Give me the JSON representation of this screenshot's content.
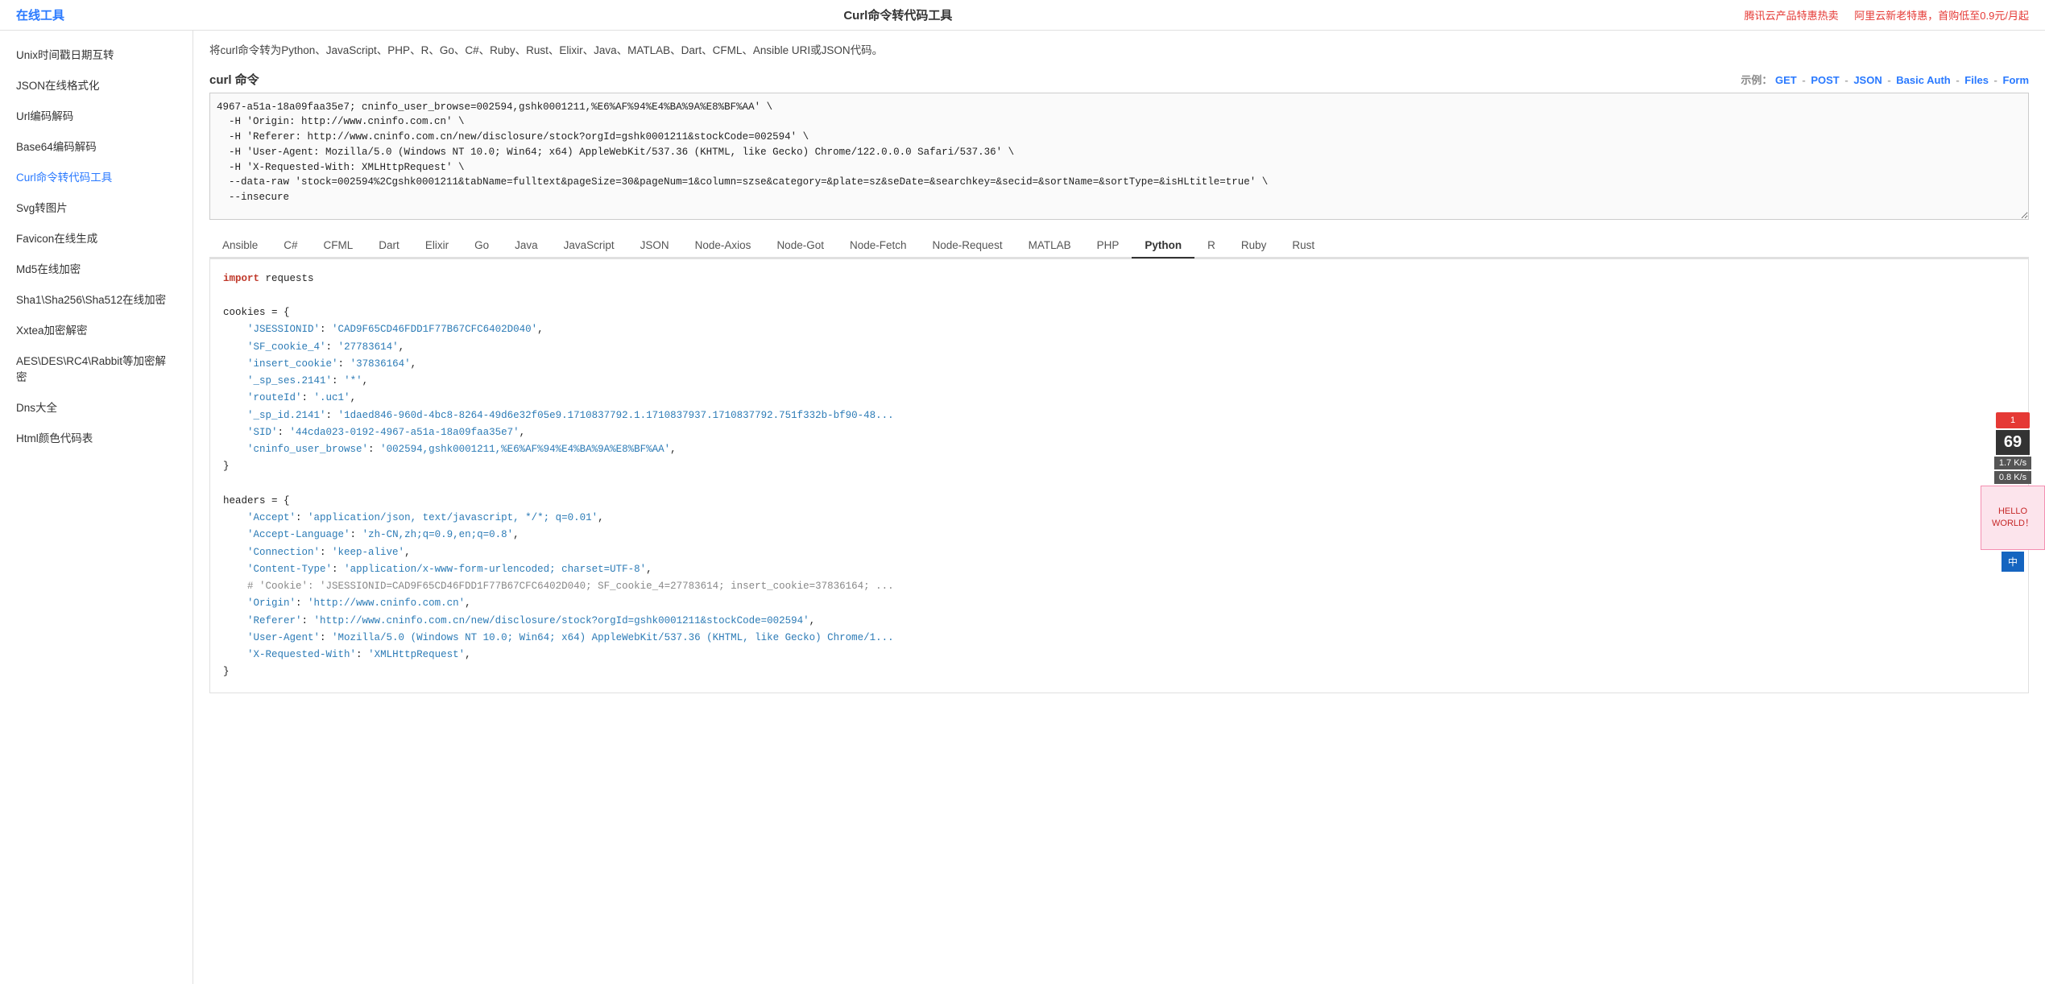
{
  "topbar": {
    "site_title": "在线工具",
    "page_title": "Curl命令转代码工具",
    "ad1": "腾讯云产品特惠热卖",
    "ad2": "阿里云新老特惠，首购低至0.9元/月起"
  },
  "sidebar": {
    "items": [
      {
        "label": "Unix时间戳日期互转",
        "active": false
      },
      {
        "label": "JSON在线格式化",
        "active": false
      },
      {
        "label": "Url编码解码",
        "active": false
      },
      {
        "label": "Base64编码解码",
        "active": false
      },
      {
        "label": "Curl命令转代码工具",
        "active": true
      },
      {
        "label": "Svg转图片",
        "active": false
      },
      {
        "label": "Favicon在线生成",
        "active": false
      },
      {
        "label": "Md5在线加密",
        "active": false
      },
      {
        "label": "Sha1\\Sha256\\Sha512在线加密",
        "active": false
      },
      {
        "label": "Xxtea加密解密",
        "active": false
      },
      {
        "label": "AES\\DES\\RC4\\Rabbit等加密解密",
        "active": false
      },
      {
        "label": "Dns大全",
        "active": false
      },
      {
        "label": "Html颜色代码表",
        "active": false
      }
    ]
  },
  "main": {
    "description": "将curl命令转为Python、JavaScript、PHP、R、Go、C#、Ruby、Rust、Elixir、Java、MATLAB、Dart、CFML、Ansible URI或JSON代码。",
    "curl_label": "curl 命令",
    "example_label": "示例：",
    "examples": [
      "GET",
      "POST",
      "JSON",
      "Basic Auth",
      "Files",
      "Form"
    ],
    "curl_content": "4967-a51a-18a09faa35e7; cninfo_user_browse=002594,gshk0001211,%E6%AF%94%E4%BA%9A%E8%BF%AA' \\\n  -H 'Origin: http://www.cninfo.com.cn' \\\n  -H 'Referer: http://www.cninfo.com.cn/new/disclosure/stock?orgId=gshk0001211&stockCode=002594' \\\n  -H 'User-Agent: Mozilla/5.0 (Windows NT 10.0; Win64; x64) AppleWebKit/537.36 (KHTML, like Gecko) Chrome/122.0.0.0 Safari/537.36' \\\n  -H 'X-Requested-With: XMLHttpRequest' \\\n  --data-raw 'stock=002594%2Cgshk0001211&tabName=fulltext&pageSize=30&pageNum=1&column=szse&category=&plate=sz&seDate=&searchkey=&secid=&sortName=&sortType=&isHLtitle=true' \\\n  --insecure",
    "lang_tabs": [
      {
        "label": "Ansible",
        "active": false
      },
      {
        "label": "C#",
        "active": false
      },
      {
        "label": "CFML",
        "active": false
      },
      {
        "label": "Dart",
        "active": false
      },
      {
        "label": "Elixir",
        "active": false
      },
      {
        "label": "Go",
        "active": false
      },
      {
        "label": "Java",
        "active": false
      },
      {
        "label": "JavaScript",
        "active": false
      },
      {
        "label": "JSON",
        "active": false
      },
      {
        "label": "Node-Axios",
        "active": false
      },
      {
        "label": "Node-Got",
        "active": false
      },
      {
        "label": "Node-Fetch",
        "active": false
      },
      {
        "label": "Node-Request",
        "active": false
      },
      {
        "label": "MATLAB",
        "active": false
      },
      {
        "label": "PHP",
        "active": false
      },
      {
        "label": "Python",
        "active": true
      },
      {
        "label": "R",
        "active": false
      },
      {
        "label": "Ruby",
        "active": false
      },
      {
        "label": "Rust",
        "active": false
      }
    ],
    "code_output": {
      "lines": [
        {
          "type": "code",
          "content": "import requests"
        },
        {
          "type": "blank"
        },
        {
          "type": "code",
          "content": "cookies = {"
        },
        {
          "type": "code",
          "content": "    'JSESSIONID': 'CAD9F65CD46FDD1F77B67CFC6402D040',"
        },
        {
          "type": "code",
          "content": "    'SF_cookie_4': '27783614',"
        },
        {
          "type": "code",
          "content": "    'insert_cookie': '37836164',"
        },
        {
          "type": "code",
          "content": "    '_sp_ses.2141': '*',"
        },
        {
          "type": "code",
          "content": "    'routeId': '.uc1',"
        },
        {
          "type": "code",
          "content": "    '_sp_id.2141': '1daed846-960d-4bc8-8264-49d6e32f05e9.1710837792.1.1710837937.1710837792.751f332b-bf90-48..."
        },
        {
          "type": "code",
          "content": "    'SID': '44cda023-0192-4967-a51a-18a09faa35e7',"
        },
        {
          "type": "code",
          "content": "    'cninfo_user_browse': '002594,gshk0001211,%E6%AF%94%E4%BA%9A%E8%BF%AA',"
        },
        {
          "type": "code",
          "content": "}"
        },
        {
          "type": "blank"
        },
        {
          "type": "code",
          "content": "headers = {"
        },
        {
          "type": "code",
          "content": "    'Accept': 'application/json, text/javascript, */*; q=0.01',"
        },
        {
          "type": "code",
          "content": "    'Accept-Language': 'zh-CN,zh;q=0.9,en;q=0.8',"
        },
        {
          "type": "code",
          "content": "    'Connection': 'keep-alive',"
        },
        {
          "type": "code",
          "content": "    'Content-Type': 'application/x-www-form-urlencoded; charset=UTF-8',"
        },
        {
          "type": "code",
          "content": "    # 'Cookie': 'JSESSIONID=CAD9F65CD46FDD1F77B67CFC6402D040; SF_cookie_4=27783614; insert_cookie=37836164; ..."
        },
        {
          "type": "code",
          "content": "    'Origin': 'http://www.cninfo.com.cn',"
        },
        {
          "type": "code",
          "content": "    'Referer': 'http://www.cninfo.com.cn/new/disclosure/stock?orgId=gshk0001211&stockCode=002594',"
        },
        {
          "type": "code",
          "content": "    'User-Agent': 'Mozilla/5.0 (Windows NT 10.0; Win64; x64) AppleWebKit/537.36 (KHTML, like Gecko) Chrome/1..."
        },
        {
          "type": "code",
          "content": "    'X-Requested-With': 'XMLHttpRequest',"
        },
        {
          "type": "code",
          "content": "}"
        }
      ]
    }
  },
  "widget": {
    "badge": "1",
    "count": "69",
    "speed1": "1.7",
    "speed1_unit": "K/s",
    "speed2": "0.8",
    "speed2_unit": "K/s",
    "img_label": "HELLO WORLD！",
    "ime_label": "中"
  }
}
